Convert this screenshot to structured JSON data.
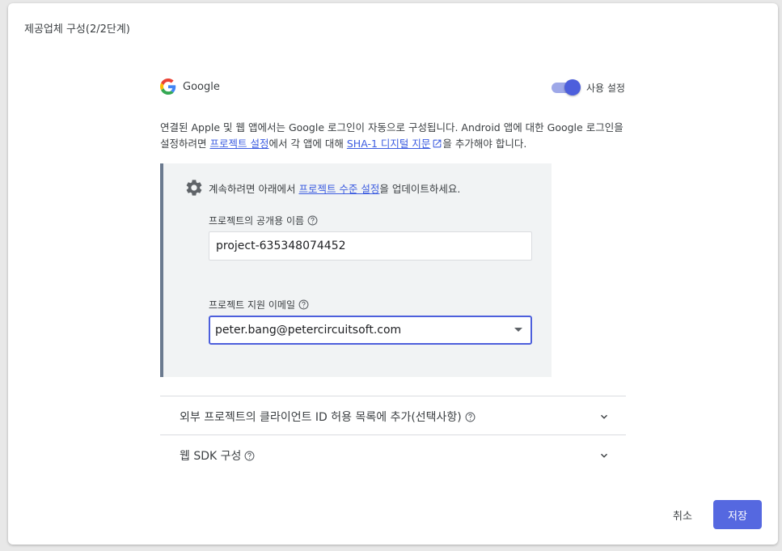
{
  "dialog": {
    "title": "제공업체 구성(2/2단계)"
  },
  "provider": {
    "name": "Google",
    "enabled": true,
    "toggle_label": "사용 설정",
    "icon": "google-logo"
  },
  "description": {
    "part1": "연결된 Apple 및 웹 앱에서는 Google 로그인이 자동으로 구성됩니다. Android 앱에 대한 Google 로그인을 설정하려면 ",
    "link1": "프로젝트 설정",
    "part2": "에서 각 앱에 대해 ",
    "link2": "SHA-1 디지털 지문",
    "part3": "을 추가해야 합니다."
  },
  "notice": {
    "prefix": "계속하려면 아래에서 ",
    "link": "프로젝트 수준 설정",
    "suffix": "을 업데이트하세요.",
    "icon": "gear-icon",
    "colors": {
      "bar": "#6b7a8f",
      "background": "#f1f3f4"
    }
  },
  "fields": {
    "public_name": {
      "label": "프로젝트의 공개용 이름",
      "value": "project-635348074452"
    },
    "support_email": {
      "label": "프로젝트 지원 이메일",
      "value": "peter.bang@petercircuitsoft.com"
    }
  },
  "accordions": [
    {
      "label": "외부 프로젝트의 클라이언트 ID 허용 목록에 추가(선택사항)"
    },
    {
      "label": "웹 SDK 구성"
    }
  ],
  "footer": {
    "cancel_label": "취소",
    "save_label": "저장"
  },
  "colors": {
    "accent": "#5568e0",
    "link": "#3c5ce0"
  }
}
